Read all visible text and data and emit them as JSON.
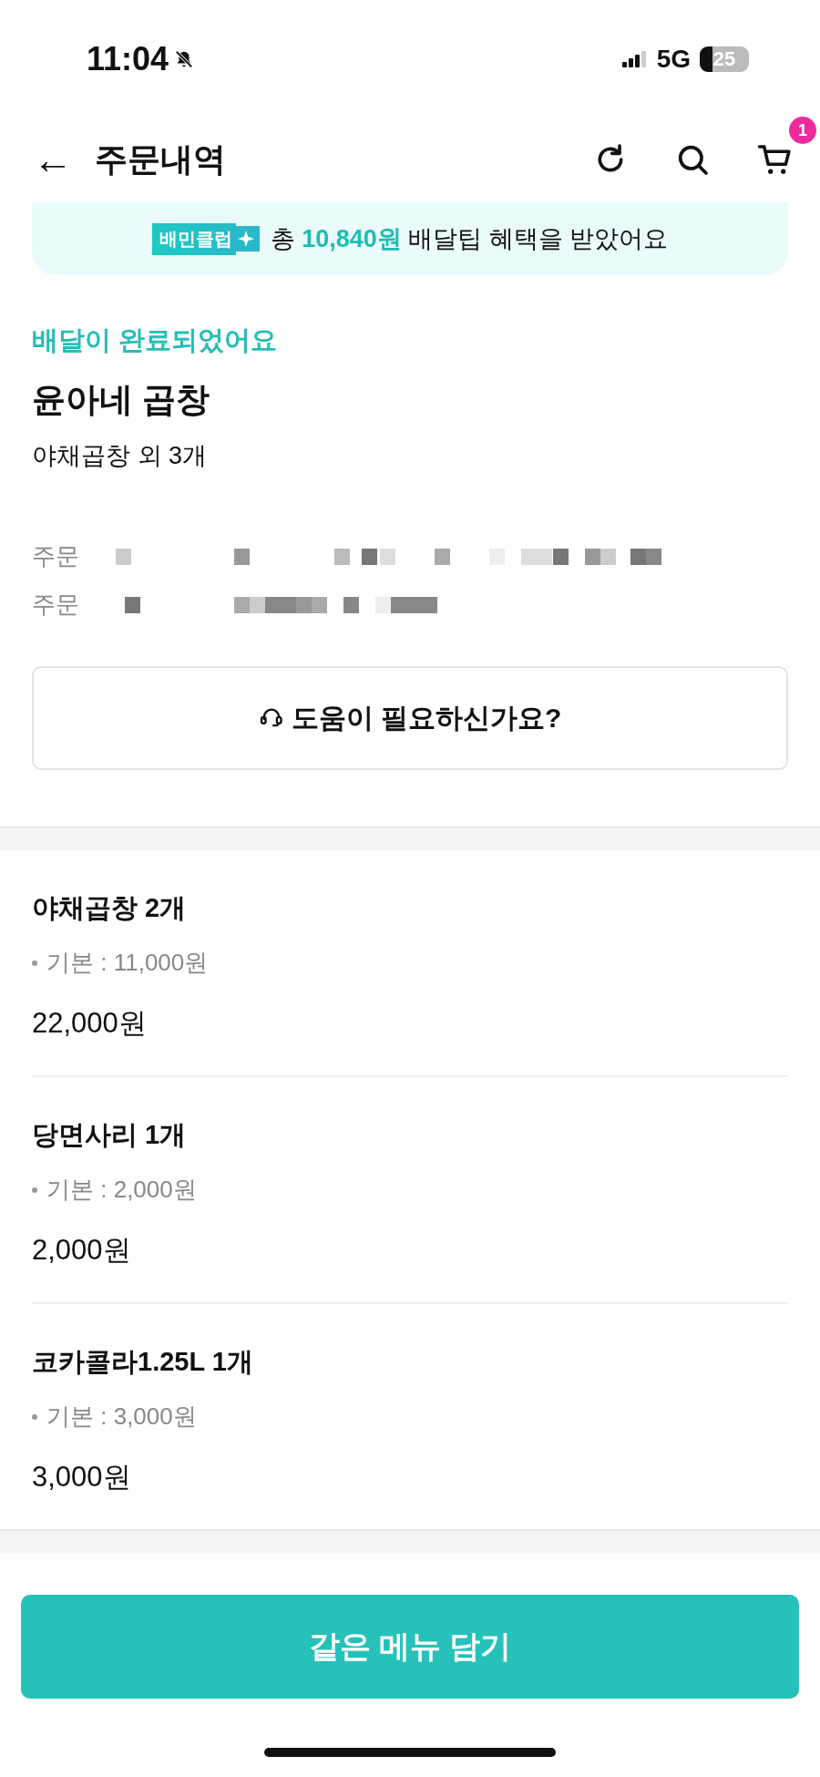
{
  "status_bar": {
    "time": "11:04",
    "network": "5G",
    "battery": "25"
  },
  "header": {
    "back": "←",
    "title": "주문내역",
    "cart_badge": "1"
  },
  "banner": {
    "tag": "배민클럽",
    "text": "총 **10,840원** 배달팁 혜택을 받았어요"
  },
  "order": {
    "status": "배달이 완료되었어요",
    "store": "윤아네 곱창",
    "summary": "야채곱창 외 3개",
    "info_rows": [
      {
        "label": "주문"
      },
      {
        "label": "주문"
      }
    ],
    "help_button": "도움이 필요하신가요?"
  },
  "items": [
    {
      "name": "야채곱창 2개",
      "option": "기본 : 11,000원",
      "price": "22,000원"
    },
    {
      "name": "당면사리 1개",
      "option": "기본 : 2,000원",
      "price": "2,000원"
    },
    {
      "name": "코카콜라1.25L 1개",
      "option": "기본 : 3,000원",
      "price": "3,000원"
    }
  ],
  "bottom_button": "같은 메뉴 담기"
}
